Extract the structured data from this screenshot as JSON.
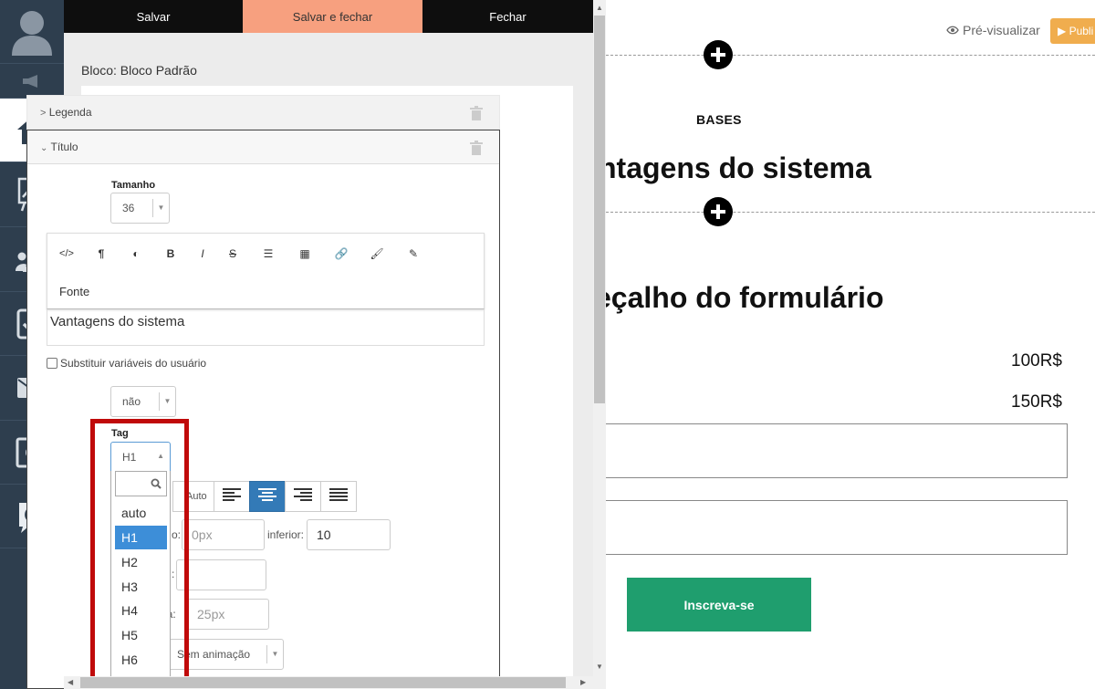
{
  "nav": {
    "items": [
      {
        "icon": "user-avatar-icon"
      },
      {
        "icon": "megaphone-icon"
      },
      {
        "icon": "home-icon"
      },
      {
        "icon": "chart-icon"
      },
      {
        "icon": "users-icon"
      },
      {
        "icon": "checkbox-icon"
      },
      {
        "icon": "mail-icon"
      },
      {
        "icon": "settings-window-icon"
      },
      {
        "icon": "brand-c-icon"
      }
    ]
  },
  "toolbar": {
    "save_label": "Salvar",
    "save_close_label": "Salvar e fechar",
    "close_label": "Fechar"
  },
  "editor": {
    "block_title": "Bloco: Bloco Padrão",
    "legenda_label": "Legenda",
    "titulo_label": "Título",
    "tamanho_label": "Tamanho",
    "tamanho_value": "36",
    "rte_fonte": "Fonte",
    "rte_content": "Vantagens do sistema",
    "substituir_label": "Substituir variáveis do usuário",
    "nao_value": "não",
    "tag_label": "Tag",
    "tag_value": "H1",
    "tag_options": [
      "auto",
      "H1",
      "H2",
      "H3",
      "H4",
      "H5",
      "H6"
    ],
    "align_auto": "Auto",
    "superior_label_partial": "o:",
    "superior_placeholder": "0px",
    "inferior_label": "inferior:",
    "inferior_value": "10",
    "altura_label_partial": ":",
    "linha_label_partial": "na:",
    "linha_placeholder": "25px",
    "animacao_value": "Sem animação"
  },
  "preview": {
    "preview_link": "Pré-visualizar",
    "publish_label": "▶ Publi",
    "bases": "BASES",
    "heading_1": "ntagens do sistema",
    "heading_2": "eçalho do formulário",
    "price_1": "100R$",
    "price_2": "150R$",
    "cta_label": "Inscreva-se"
  },
  "colors": {
    "nav_bg": "#2e3e4e",
    "save_close_bg": "#f7a07f",
    "select_highlight": "#3d8ed8",
    "annotation_red": "#c00a0a",
    "cta_green": "#1f9e6e",
    "publish_orange": "#f0ad4e"
  }
}
